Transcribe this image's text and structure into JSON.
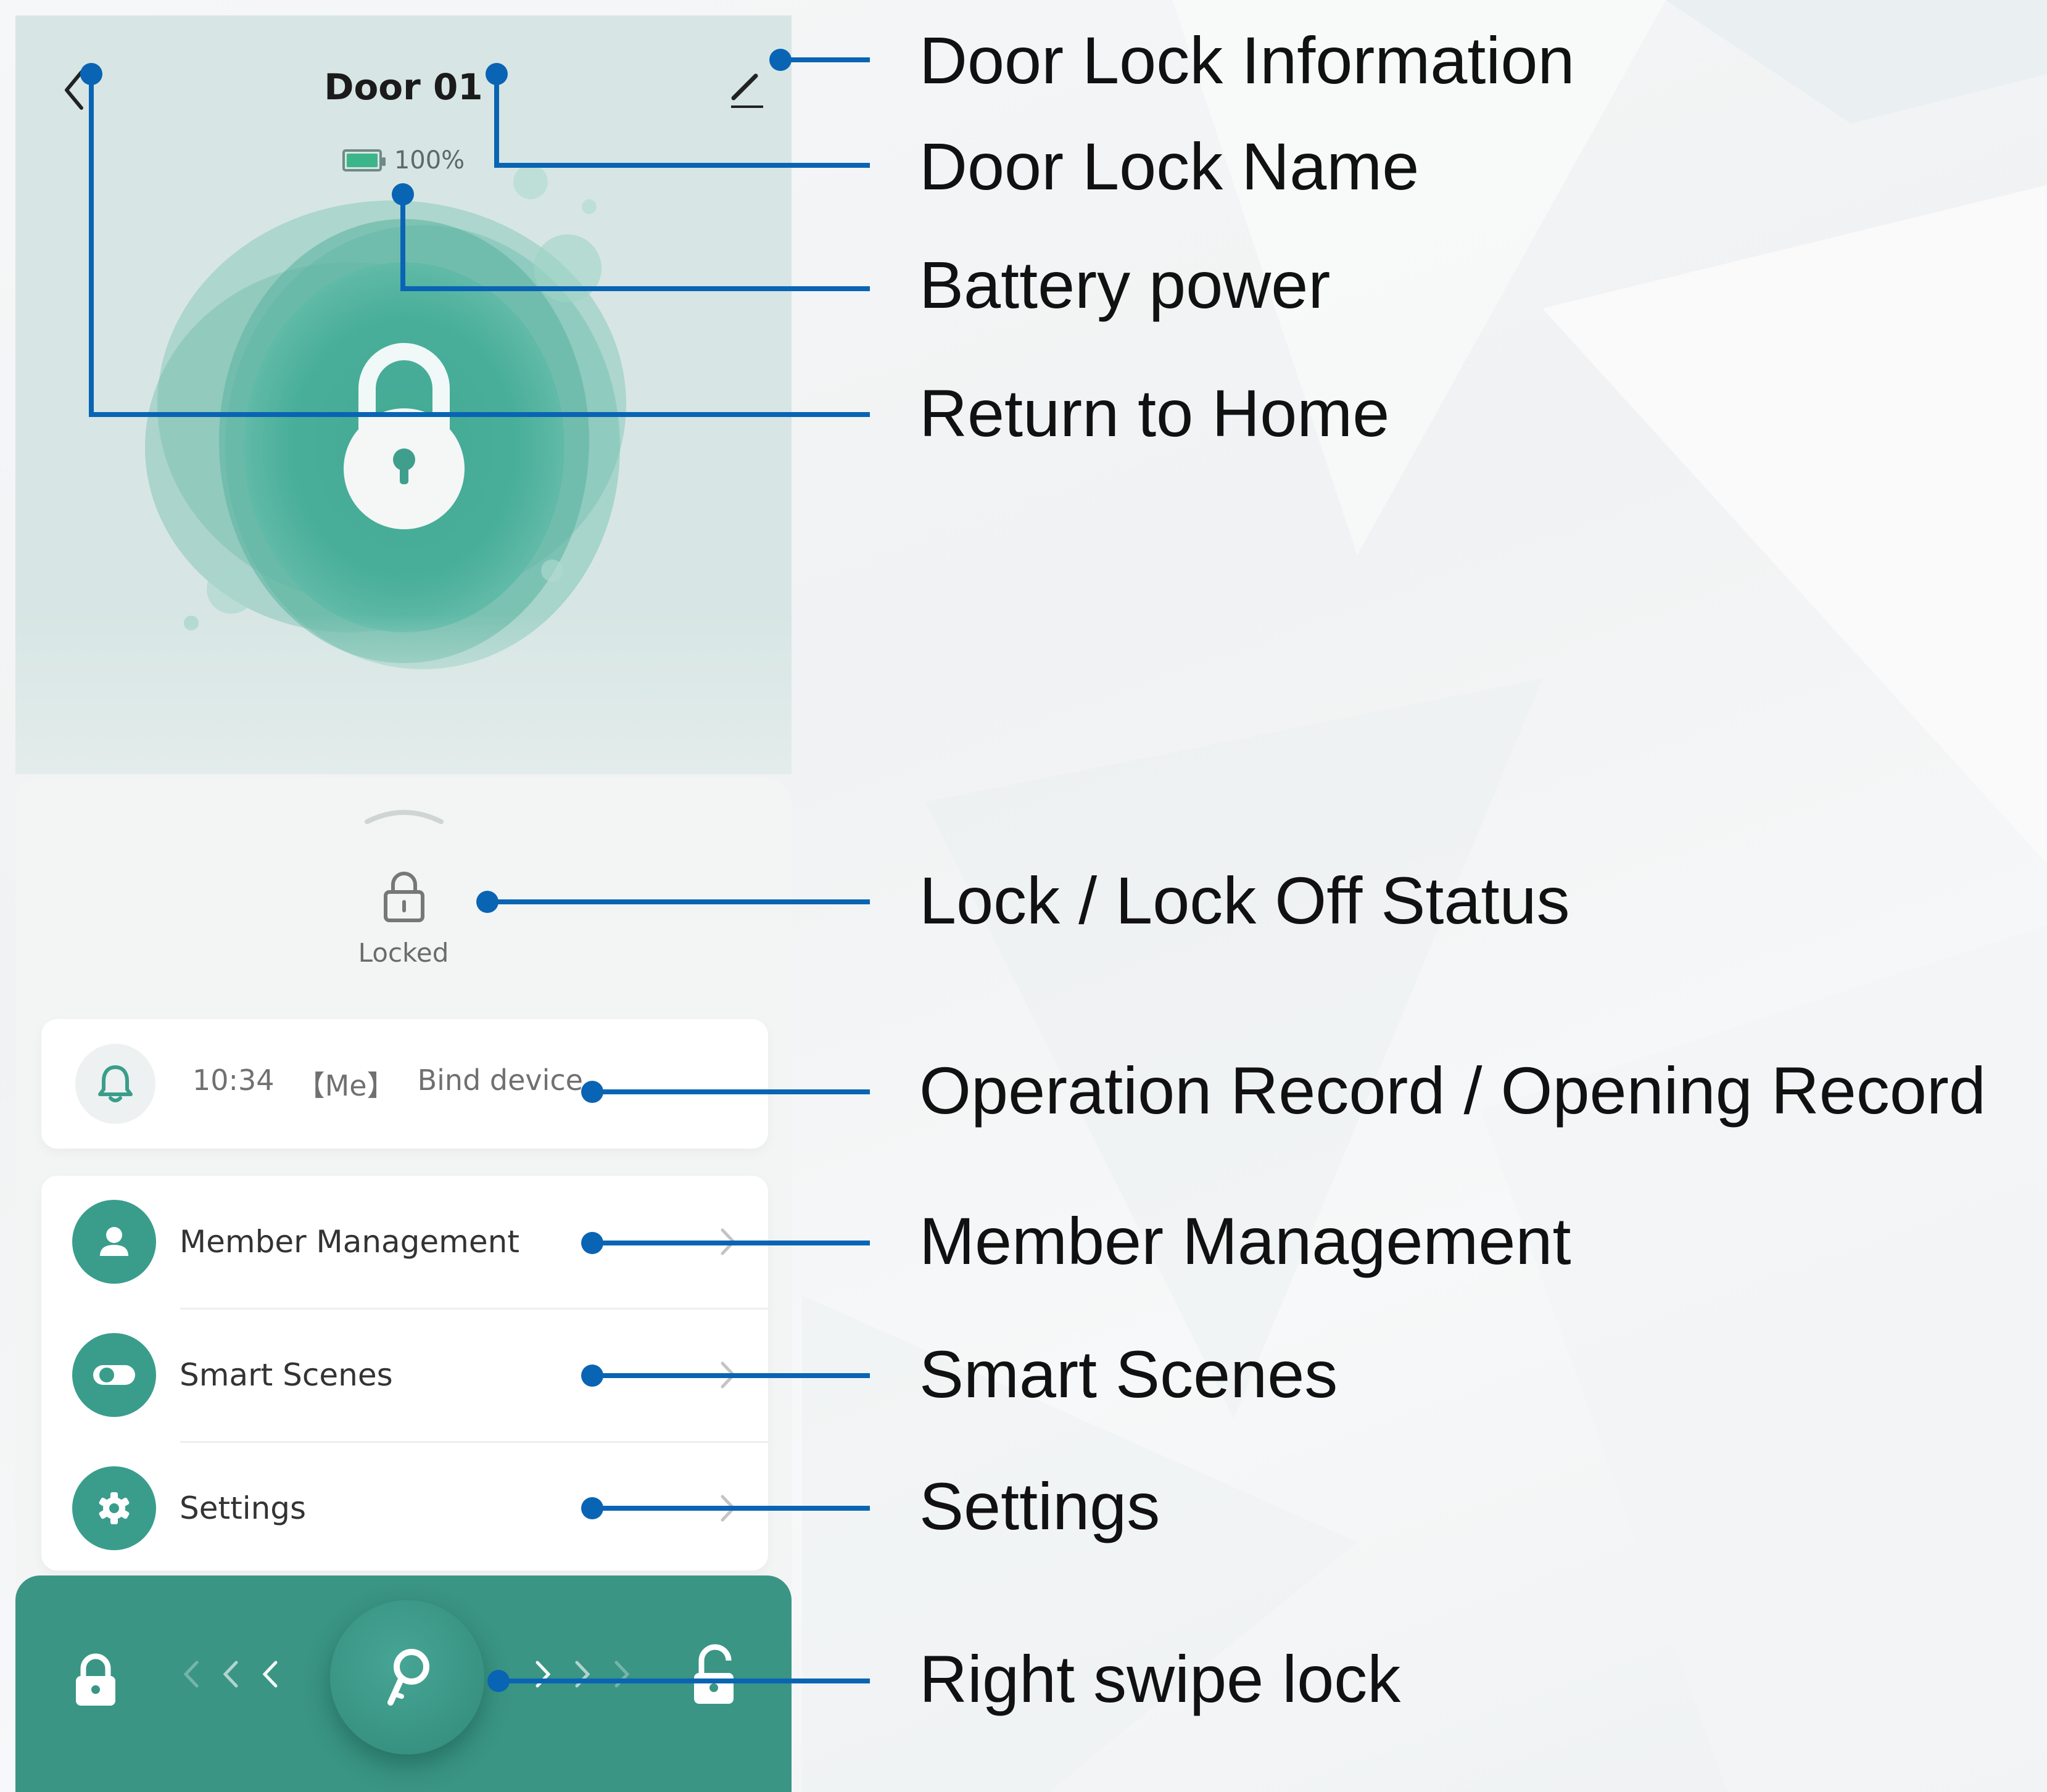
{
  "colors": {
    "accent": "#3a9584",
    "annotation_line": "#0a64b4",
    "battery_fill": "#3db58a"
  },
  "header": {
    "back_icon": "chevron-left-icon",
    "device_name": "Door 01",
    "edit_icon": "pencil-icon"
  },
  "battery": {
    "icon": "battery-icon",
    "level_percent": 100,
    "label": "100%"
  },
  "lock_visual": {
    "icon": "padlock-icon"
  },
  "status": {
    "icon": "padlock-small-icon",
    "label": "Locked"
  },
  "record": {
    "icon": "bell-icon",
    "time": "10:34",
    "actor": "【Me】",
    "action": "Bind device"
  },
  "menu": [
    {
      "label": "Member Management",
      "icon": "person-icon"
    },
    {
      "label": "Smart Scenes",
      "icon": "toggle-icon"
    },
    {
      "label": "Settings",
      "icon": "gear-icon"
    }
  ],
  "swipe": {
    "lock_icon": "lock-icon",
    "knob_icon": "key-icon",
    "unlock_icon": "unlock-icon"
  },
  "annotations": [
    "Door Lock Information",
    "Door Lock Name",
    "Battery power",
    "Return to Home",
    "Lock / Lock Off Status",
    "Operation Record / Opening Record",
    "Member Management",
    "Smart Scenes",
    "Settings",
    "Right swipe lock"
  ]
}
